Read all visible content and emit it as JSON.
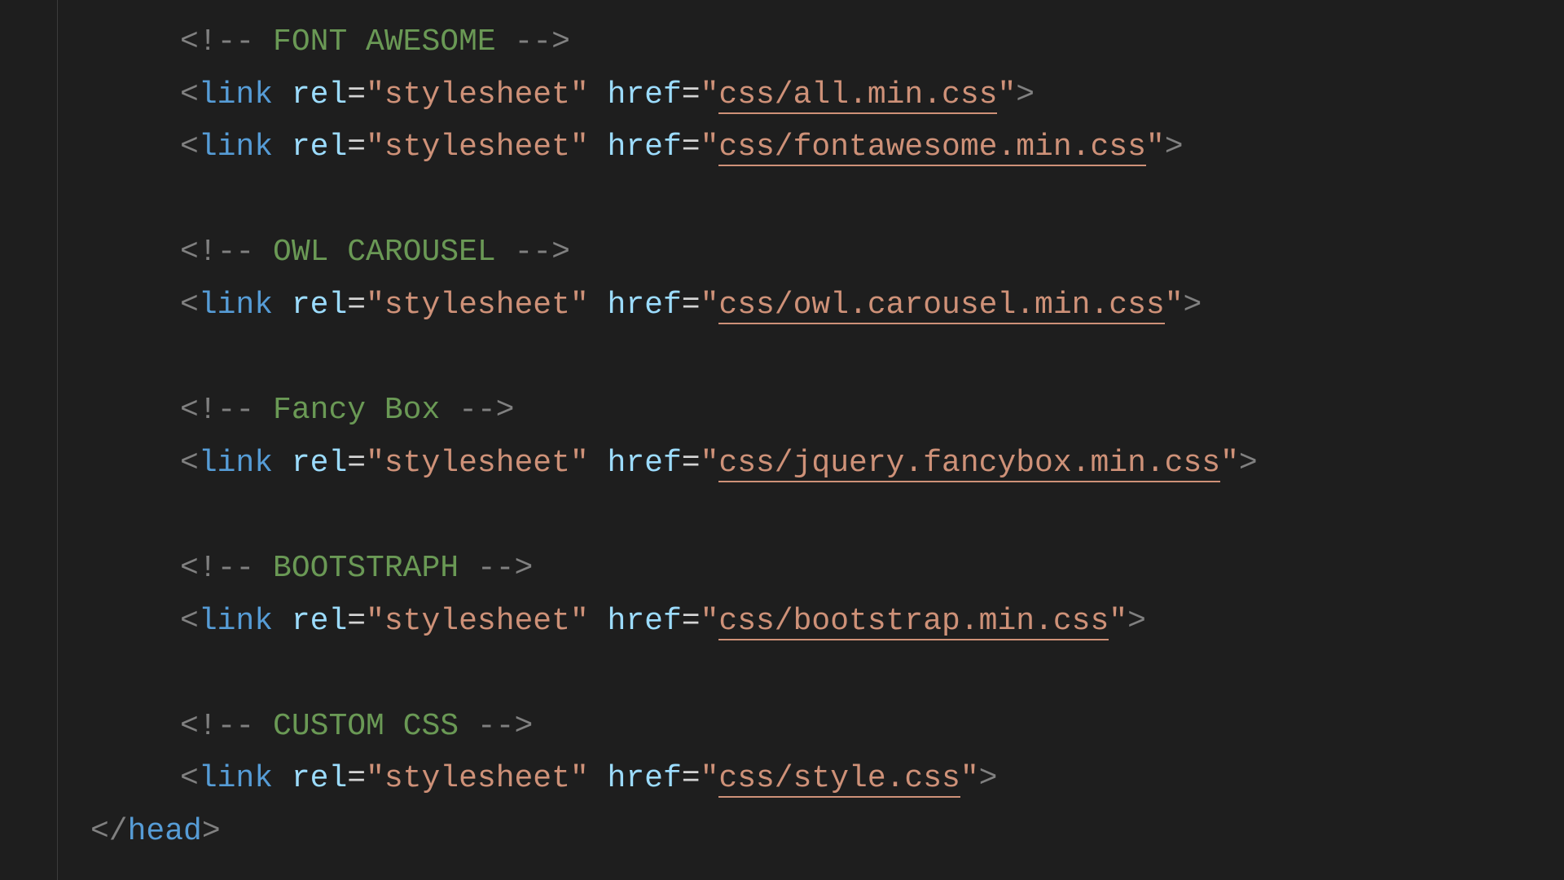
{
  "tokens": {
    "lt": "<",
    "gt": ">",
    "ltbang": "<!--",
    "bangend": "-->",
    "link": "link",
    "rel": "rel",
    "href": "href",
    "eq": "=",
    "q": "\"",
    "stylesheet": "stylesheet",
    "slash": "/",
    "head": "head"
  },
  "groups": [
    {
      "comment": "FONT AWESOME",
      "hrefs": [
        "css/all.min.css",
        "css/fontawesome.min.css"
      ]
    },
    {
      "comment": "OWL CAROUSEL",
      "hrefs": [
        "css/owl.carousel.min.css"
      ]
    },
    {
      "comment": "Fancy Box",
      "hrefs": [
        "css/jquery.fancybox.min.css"
      ]
    },
    {
      "comment": "BOOTSTRAPH",
      "hrefs": [
        "css/bootstrap.min.css"
      ]
    },
    {
      "comment": "CUSTOM CSS",
      "hrefs": [
        "css/style.css"
      ]
    }
  ],
  "closing_tag": "head"
}
